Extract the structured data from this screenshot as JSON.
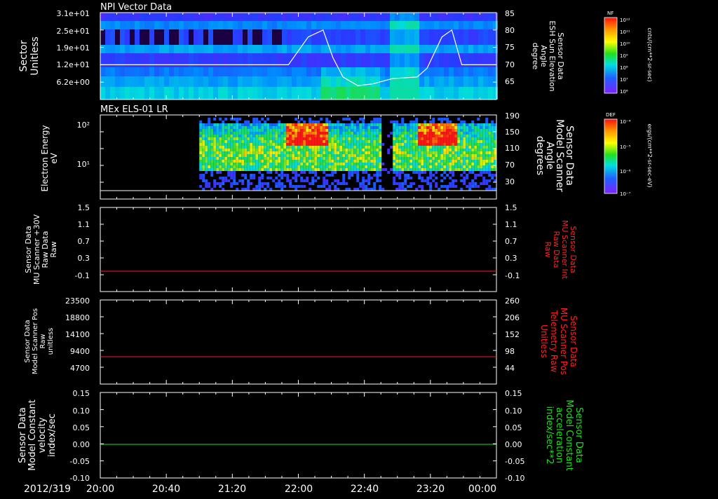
{
  "time_axis": {
    "date_label": "2012/319",
    "tick_labels": [
      "20:00",
      "20:40",
      "21:20",
      "22:00",
      "22:40",
      "23:20",
      "00:00"
    ]
  },
  "colors": {
    "frame": "#ffffff",
    "red_trace": "#ff2020",
    "green_trace": "#22dd22",
    "background": "#000000"
  },
  "chart_data": [
    {
      "type": "heatmap",
      "title": "NPI Vector Data",
      "ylabel_left": [
        "Sector",
        "Unitless"
      ],
      "ylabel_right": [
        "Sensor Data",
        "ESH Sun Elevation",
        "Angle",
        "degree"
      ],
      "left_ticks": [
        "3.1e+01",
        "2.5e+01",
        "1.9e+01",
        "1.2e+01",
        "6.2e+00"
      ],
      "right_ticks": [
        "85",
        "80",
        "75",
        "70",
        "65"
      ],
      "ylim_right": [
        60,
        85
      ],
      "overlay_line": {
        "x_hours": [
          20.0,
          21.9,
          22.1,
          22.25,
          22.35,
          22.45,
          22.6,
          22.75,
          22.95,
          23.2,
          23.3,
          23.45,
          23.55,
          23.65,
          24.0
        ],
        "values": [
          70,
          70,
          78,
          80,
          72,
          66.5,
          64,
          64.5,
          66,
          66.5,
          69,
          78,
          80,
          70,
          70
        ]
      },
      "colorbar": {
        "label_top": "NF",
        "unit": "cnts/(cm**2-sr-sec)",
        "tick_labels": [
          "10¹²",
          "10¹¹",
          "10¹⁰",
          "10⁹",
          "10⁸",
          "10⁷",
          "10⁶"
        ]
      }
    },
    {
      "type": "heatmap",
      "title": "MEx ELS-01 LR",
      "ylabel_left": [
        "Electron Energy",
        "eV"
      ],
      "ylabel_right": [
        "Sensor Data",
        "Model Scanner",
        "Angle",
        "degrees"
      ],
      "left_ticks": [
        "10²",
        "10¹"
      ],
      "right_ticks": [
        "190",
        "150",
        "110",
        "70",
        "30"
      ],
      "ylim_right": [
        -10,
        190
      ],
      "colorbar": {
        "label_top": "DEF",
        "unit": "ergs/(cm**2-sr-sec-eV)",
        "tick_labels": [
          "10⁻⁴",
          "10⁻⁵",
          "10⁻⁶",
          "10⁻⁷"
        ]
      }
    },
    {
      "type": "line",
      "ylabel_left": [
        "Sensor Data",
        "MU Scanner +30V",
        "Raw Data",
        "Raw"
      ],
      "ylabel_right": [
        "Sensor Data",
        "MU Scanner Int",
        "Raw Data",
        "Raw"
      ],
      "left_ticks": [
        "1.5",
        "1.1",
        "0.7",
        "0.3",
        "-0.1"
      ],
      "right_ticks": [
        "1.5",
        "1.1",
        "0.7",
        "0.3",
        "-0.1"
      ],
      "ylim": [
        -0.4,
        1.5
      ],
      "series": [
        {
          "color": "red",
          "constant_value": 0.0
        }
      ]
    },
    {
      "type": "line",
      "ylabel_left": [
        "Sensor Data",
        "Model Scanner Pos",
        "Raw",
        "unitless"
      ],
      "ylabel_right": [
        "Sensor Data",
        "MU Scanner Pos",
        "Telemetry Raw",
        "Unitless"
      ],
      "left_ticks": [
        "23500",
        "18800",
        "14100",
        "9400",
        "4700"
      ],
      "right_ticks": [
        "260",
        "206",
        "152",
        "98",
        "44"
      ],
      "ylim": [
        0,
        23500
      ],
      "series": [
        {
          "color": "red",
          "constant_value": 8200
        }
      ]
    },
    {
      "type": "line",
      "ylabel_left": [
        "Sensor Data",
        "Model Constant",
        "velocity",
        "index/sec"
      ],
      "ylabel_right": [
        "Sensor Data",
        "Model Constant",
        "acceleration",
        "index/sec**2"
      ],
      "left_ticks": [
        "0.15",
        "0.10",
        "0.05",
        "0.00",
        "-0.05",
        "-0.10"
      ],
      "right_ticks": [
        "0.15",
        "0.10",
        "0.05",
        "0.00",
        "-0.05",
        "-0.10"
      ],
      "ylim": [
        -0.1,
        0.15
      ],
      "series": [
        {
          "color": "green",
          "constant_value": 0.0
        }
      ]
    }
  ]
}
